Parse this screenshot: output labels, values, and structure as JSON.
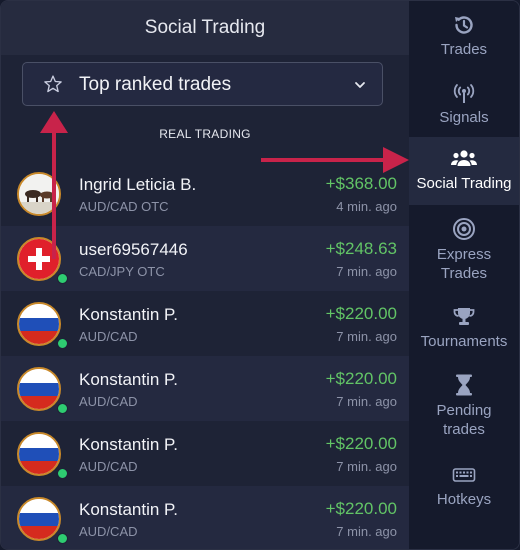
{
  "panel": {
    "title": "Social Trading",
    "dropdown_label": "Top ranked trades",
    "section_label": "REAL TRADING"
  },
  "trades": [
    {
      "name": "Ingrid Leticia B.",
      "pair": "AUD/CAD OTC",
      "amount": "+$368.00",
      "time": "4 min. ago",
      "avatar": "animal-photo"
    },
    {
      "name": "user69567446",
      "pair": "CAD/JPY OTC",
      "amount": "+$248.63",
      "time": "7 min. ago",
      "avatar": "swiss-flag"
    },
    {
      "name": "Konstantin P.",
      "pair": "AUD/CAD",
      "amount": "+$220.00",
      "time": "7 min. ago",
      "avatar": "russian-flag"
    },
    {
      "name": "Konstantin P.",
      "pair": "AUD/CAD",
      "amount": "+$220.00",
      "time": "7 min. ago",
      "avatar": "russian-flag"
    },
    {
      "name": "Konstantin P.",
      "pair": "AUD/CAD",
      "amount": "+$220.00",
      "time": "7 min. ago",
      "avatar": "russian-flag"
    },
    {
      "name": "Konstantin P.",
      "pair": "AUD/CAD",
      "amount": "+$220.00",
      "time": "7 min. ago",
      "avatar": "russian-flag"
    }
  ],
  "sidebar": {
    "items": [
      {
        "label": "Trades",
        "icon": "history-icon"
      },
      {
        "label": "Signals",
        "icon": "signal-antenna-icon"
      },
      {
        "label": "Social Trading",
        "icon": "users-group-icon"
      },
      {
        "label": "Express Trades",
        "icon": "target-icon"
      },
      {
        "label": "Tournaments",
        "icon": "trophy-icon"
      },
      {
        "label": "Pending trades",
        "icon": "hourglass-icon"
      },
      {
        "label": "Hotkeys",
        "icon": "keyboard-icon"
      }
    ]
  },
  "colors": {
    "accent_arrow": "#c8234a",
    "profit_green": "#62c466",
    "online_dot": "#2ecc71"
  }
}
